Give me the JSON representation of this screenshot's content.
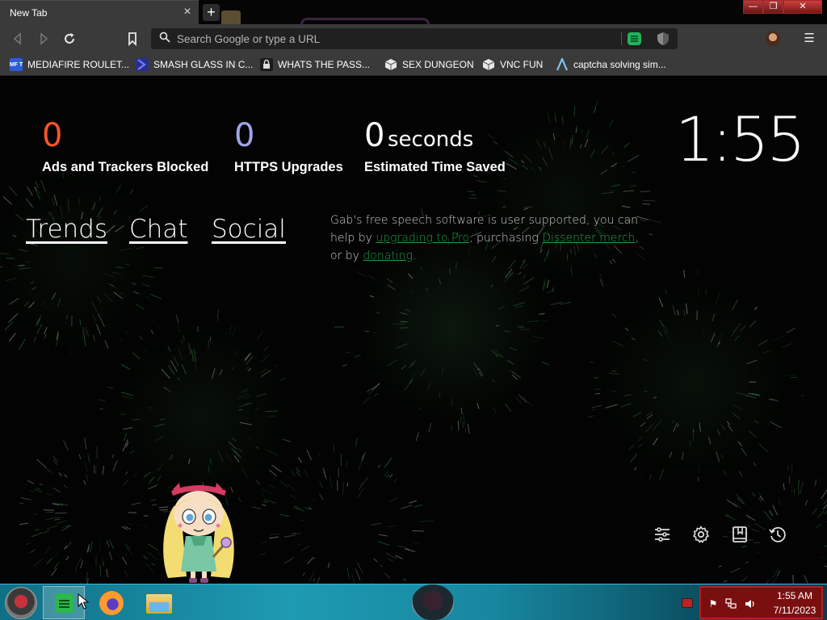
{
  "browser": {
    "tab_title": "New Tab",
    "tab_close": "×",
    "new_tab": "+",
    "address_placeholder": "Search Google or type a URL",
    "menu": "☰"
  },
  "bookmarks": [
    {
      "label": "MEDIAFIRE ROULET...",
      "icon": "mediafire-icon",
      "icon_text": "MF T",
      "color": "#2b5bd8"
    },
    {
      "label": "SMASH GLASS IN C...",
      "icon": "smash-glass-icon",
      "color": "#2f3fd6"
    },
    {
      "label": "WHATS THE PASS...",
      "icon": "lock-site-icon",
      "color": "#222222"
    },
    {
      "label": "SEX DUNGEON",
      "icon": "dungeon-cube-icon",
      "color": "#cccccc"
    },
    {
      "label": "VNC FUN",
      "icon": "vnc-cube-icon",
      "color": "#cccccc"
    },
    {
      "label": "captcha solving sim...",
      "icon": "captcha-a-icon",
      "color": "#67b5e6"
    }
  ],
  "stats": {
    "ads_count": "0",
    "ads_label": "Ads and Trackers Blocked",
    "https_count": "0",
    "https_label": "HTTPS Upgrades",
    "time_count": "0",
    "time_unit": "seconds",
    "time_label": "Estimated Time Saved"
  },
  "clock": "1:55",
  "top_links": [
    "Trends",
    "Chat",
    "Social"
  ],
  "gab_message": {
    "part1": "Gab's free speech software is user supported, you can help by ",
    "link1": "upgrading to Pro",
    "part2": ", purchasing ",
    "link2": "Dissenter merch",
    "part3": ", or by ",
    "link3": "donating",
    "part4": "."
  },
  "ntp_tools": [
    "customize-icon",
    "settings-gear-icon",
    "bookmarks-icon",
    "history-icon"
  ],
  "taskbar": {
    "time": "1:55 AM",
    "date": "7/11/2023"
  },
  "colors": {
    "ads_count": "#fb542b",
    "https_count": "#a0a5eb",
    "link_green": "#1f9d4a",
    "tray_bg": "#7a0f0f"
  }
}
